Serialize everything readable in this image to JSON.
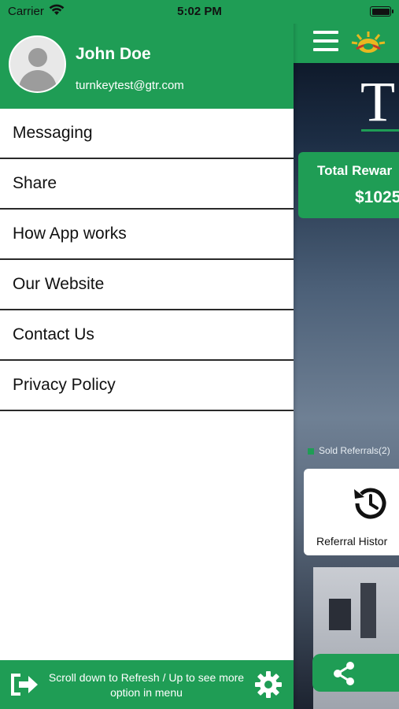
{
  "status_bar": {
    "carrier": "Carrier",
    "time": "5:02 PM"
  },
  "drawer": {
    "user": {
      "name": "John Doe",
      "email": "turnkeytest@gtr.com"
    },
    "menu": [
      {
        "label": "Messaging"
      },
      {
        "label": "Share"
      },
      {
        "label": "How App works"
      },
      {
        "label": "Our Website"
      },
      {
        "label": "Contact Us"
      },
      {
        "label": "Privacy Policy"
      }
    ],
    "footer": {
      "hint_line1": "Scroll down to Refresh / Up to see more",
      "hint_line2": "option in menu"
    }
  },
  "background": {
    "brand_letter": "T",
    "rewards": {
      "title": "Total Rewar",
      "amount": "$1025"
    },
    "legend": "Sold Referrals(2)",
    "history_label": "Referral Histor"
  },
  "colors": {
    "brand_green": "#1f9d55",
    "text": "#111111",
    "divider": "#2a2a2a"
  }
}
